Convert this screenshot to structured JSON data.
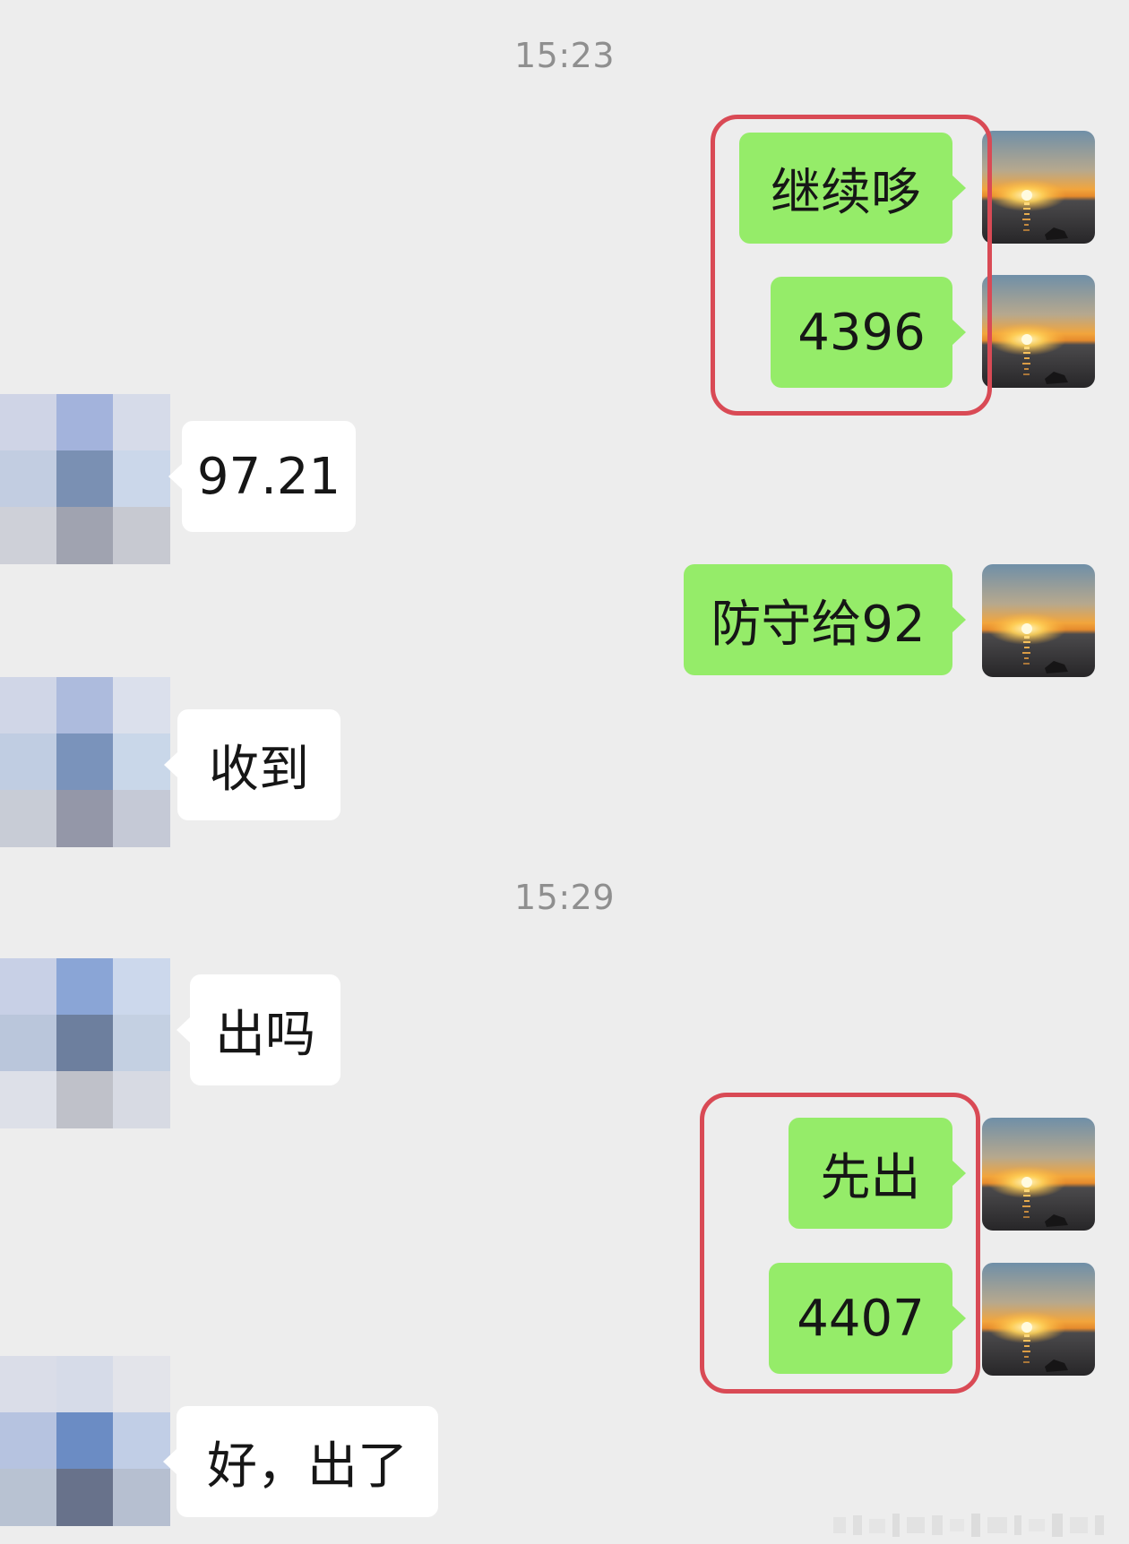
{
  "conversation": {
    "timestamps": [
      "15:23",
      "15:29"
    ],
    "messages": [
      {
        "sender": "me",
        "text": "继续哆"
      },
      {
        "sender": "me",
        "text": "4396"
      },
      {
        "sender": "other",
        "text": "97.21"
      },
      {
        "sender": "me",
        "text": "防守给92"
      },
      {
        "sender": "other",
        "text": "收到"
      },
      {
        "sender": "other",
        "text": "出吗"
      },
      {
        "sender": "me",
        "text": "先出"
      },
      {
        "sender": "me",
        "text": "4407"
      },
      {
        "sender": "other",
        "text": "好，出了"
      }
    ]
  },
  "colors": {
    "background": "#ededed",
    "my_bubble": "#95ec69",
    "their_bubble": "#ffffff",
    "highlight_border": "#d94a55",
    "timestamp_text": "#8f8f8f"
  },
  "icons": {
    "my_avatar": "sunset-over-sea-photo",
    "their_avatar": "pixelated-mosaic-avatar"
  }
}
